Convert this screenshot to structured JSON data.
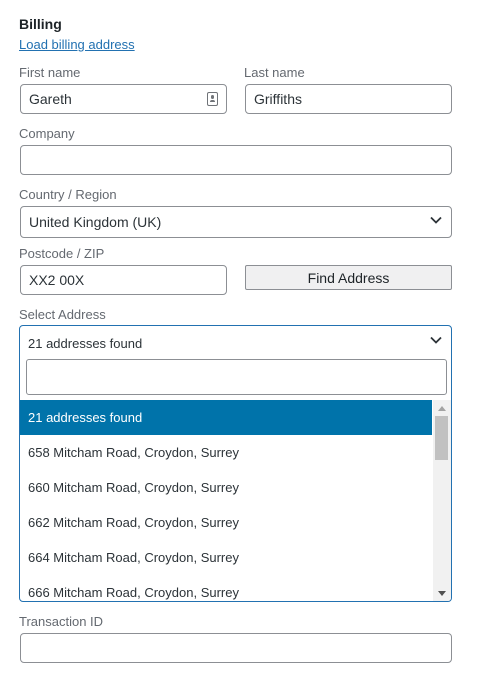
{
  "section": {
    "title": "Billing",
    "load_link": "Load billing address"
  },
  "fields": {
    "first_name": {
      "label": "First name",
      "value": "Gareth",
      "icon": "contact-card-icon"
    },
    "last_name": {
      "label": "Last name",
      "value": "Griffiths"
    },
    "company": {
      "label": "Company",
      "value": ""
    },
    "country": {
      "label": "Country / Region",
      "value": "United Kingdom (UK)"
    },
    "postcode": {
      "label": "Postcode / ZIP",
      "value": "XX2 00X"
    },
    "find_button": "Find Address",
    "select_address": {
      "label": "Select Address",
      "selected": "21 addresses found",
      "search_value": "",
      "options": [
        "21 addresses found",
        "658 Mitcham Road, Croydon, Surrey",
        "660 Mitcham Road, Croydon, Surrey",
        "662 Mitcham Road, Croydon, Surrey",
        "664 Mitcham Road, Croydon, Surrey",
        "666 Mitcham Road, Croydon, Surrey"
      ],
      "active_index": 0
    },
    "transaction_id": {
      "label": "Transaction ID",
      "value": ""
    }
  },
  "colors": {
    "accent": "#2271b1",
    "highlight": "#0073aa",
    "border": "#8c8f94"
  }
}
